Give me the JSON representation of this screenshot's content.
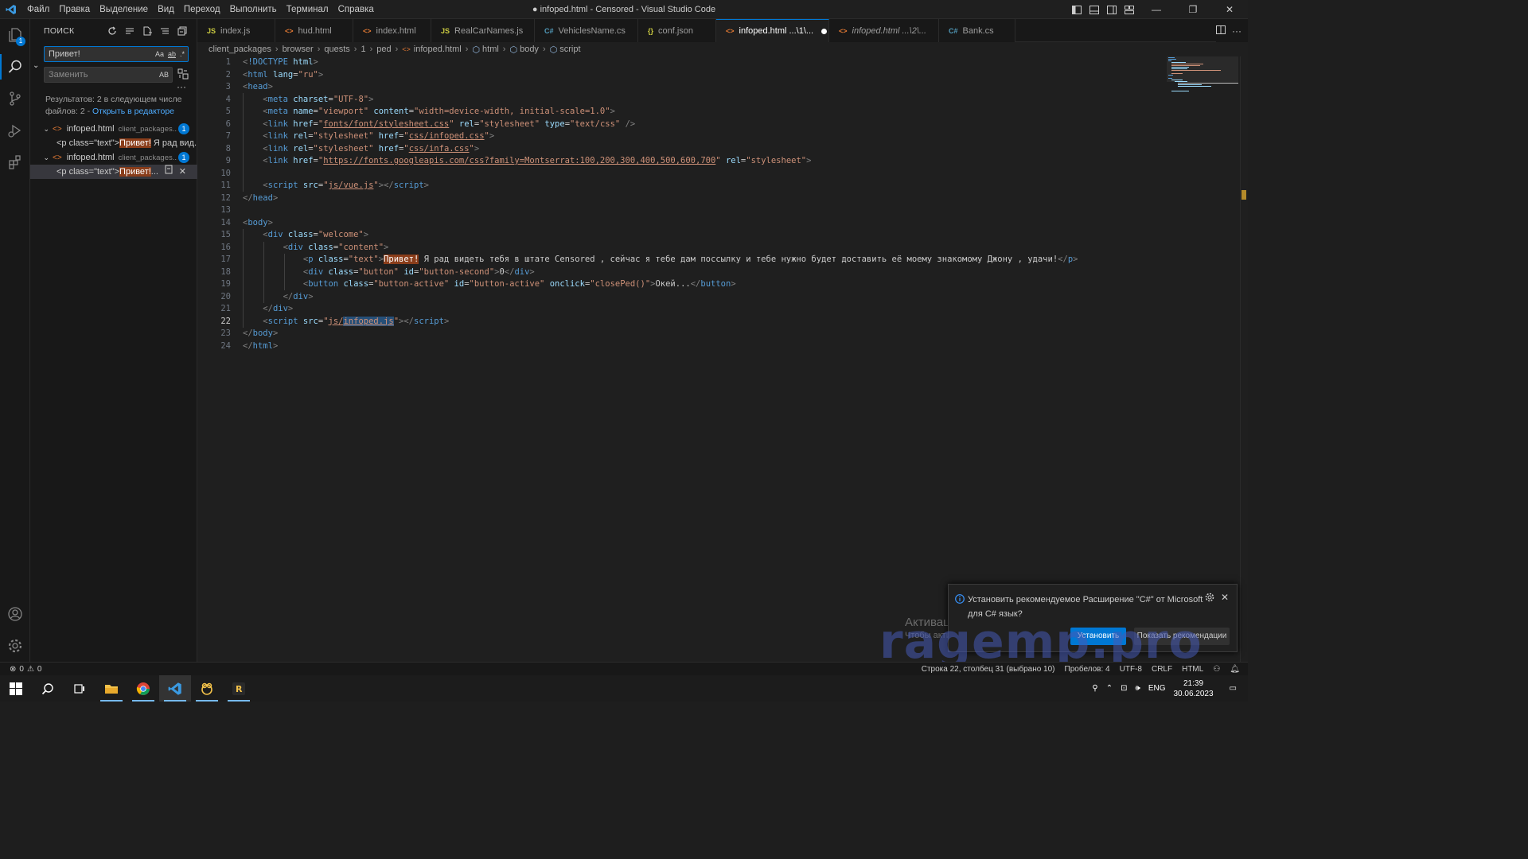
{
  "window": {
    "title": "● infoped.html - Censored - Visual Studio Code",
    "menu": [
      "Файл",
      "Правка",
      "Выделение",
      "Вид",
      "Переход",
      "Выполнить",
      "Терминал",
      "Справка"
    ]
  },
  "sidebar": {
    "title": "ПОИСК",
    "search_value": "Привет!",
    "replace_placeholder": "Заменить",
    "options": [
      "Aa",
      "ab",
      ".*"
    ],
    "replace_option": "AB",
    "results_text": "Результатов: 2 в следующем числе файлов: 2 - ",
    "open_in_editor": "Открыть в редакторе",
    "files": [
      {
        "name": "infoped.html",
        "path": "client_packages...",
        "count": "1",
        "match_prefix": "<p class=\"text\">",
        "match_hl": "Привет!",
        "match_suffix": " Я рад вид..."
      },
      {
        "name": "infoped.html",
        "path": "client_packages...",
        "count": "1",
        "match_prefix": "<p class=\"text\">",
        "match_hl": "Привет!",
        "match_suffix": "..."
      }
    ]
  },
  "tabs": [
    {
      "icon": "JS",
      "label": "index.js"
    },
    {
      "icon": "<>",
      "label": "hud.html"
    },
    {
      "icon": "<>",
      "label": "index.html"
    },
    {
      "icon": "JS",
      "label": "RealCarNames.js"
    },
    {
      "icon": "C#",
      "label": "VehiclesName.cs"
    },
    {
      "icon": "{}",
      "label": "conf.json"
    },
    {
      "icon": "<>",
      "label": "infoped.html ...\\1\\..."
    },
    {
      "icon": "<>",
      "label": "infoped.html ...\\2\\..."
    },
    {
      "icon": "C#",
      "label": "Bank.cs"
    }
  ],
  "breadcrumb": [
    "client_packages",
    "browser",
    "quests",
    "1",
    "ped",
    "infoped.html",
    "html",
    "body",
    "script"
  ],
  "editor": {
    "line_numbers": [
      "1",
      "2",
      "3",
      "4",
      "5",
      "6",
      "7",
      "8",
      "9",
      "10",
      "11",
      "12",
      "13",
      "14",
      "15",
      "16",
      "17",
      "18",
      "19",
      "20",
      "21",
      "22",
      "23",
      "24"
    ],
    "current_line": "22"
  },
  "notification": {
    "message": "Установить рекомендуемое Расширение \"C#\" от Microsoft для C# язык?",
    "install": "Установить",
    "show": "Показать рекомендации"
  },
  "watermark": {
    "activate_title": "Активация Windows",
    "activate_sub": "Чтобы активировать Windows, перейдите в раздел",
    "brand": "ragemp.pro"
  },
  "statusbar": {
    "errors": "0",
    "warnings": "0",
    "position": "Строка 22, столбец 31 (выбрано 10)",
    "spaces": "Пробелов: 4",
    "encoding": "UTF-8",
    "eol": "CRLF",
    "language": "HTML"
  },
  "taskbar": {
    "lang": "ENG",
    "time": "21:39",
    "date": "30.06.2023"
  },
  "colors": {
    "accent": "#0078d4",
    "tag": "#569cd6",
    "attribute": "#9cdcfe",
    "string": "#ce9178",
    "match_highlight": "#8a3d1a"
  }
}
